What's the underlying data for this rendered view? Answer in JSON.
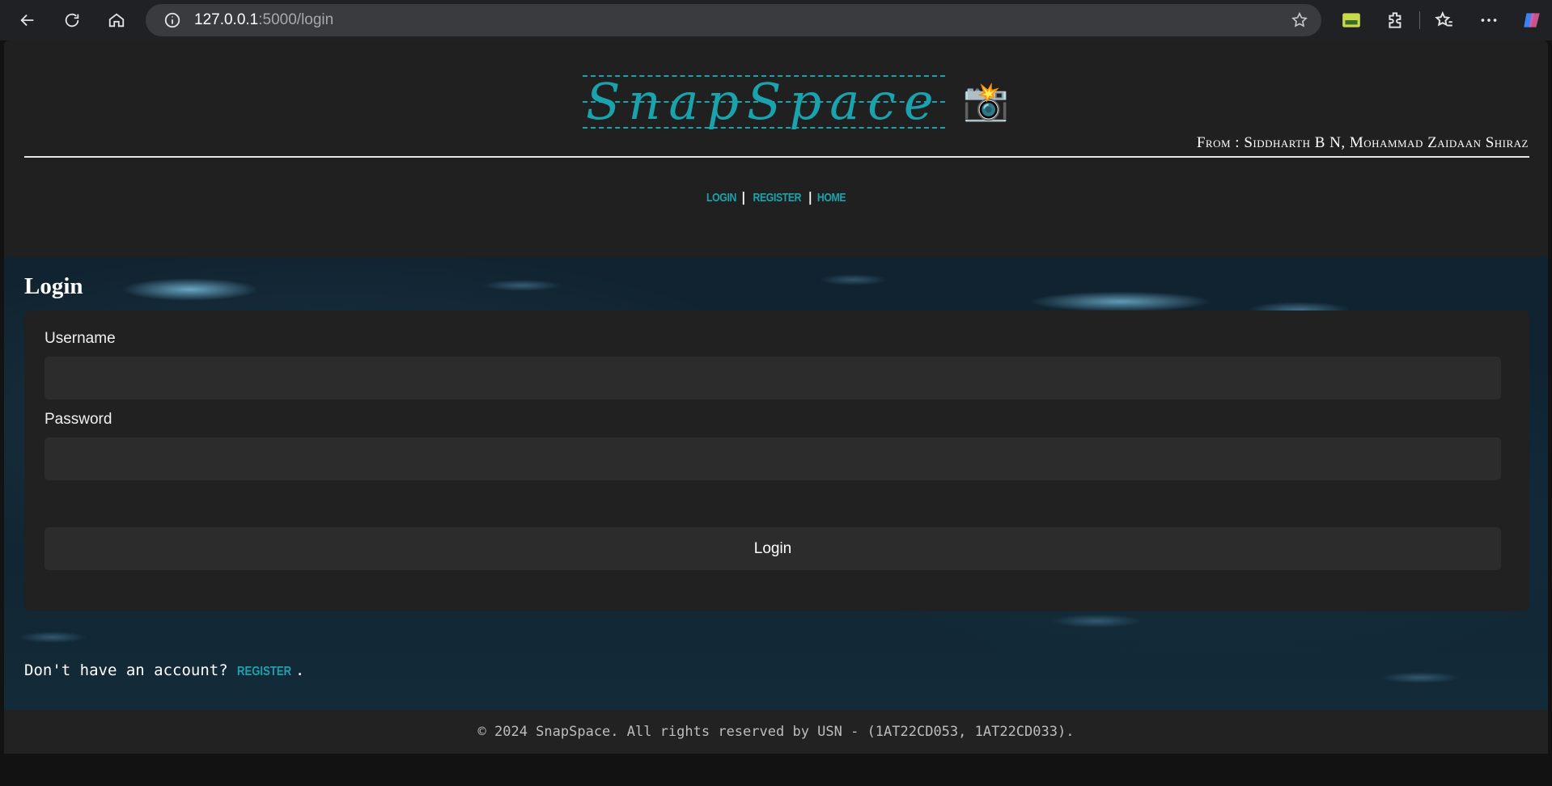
{
  "browser": {
    "url_host": "127.0.0.1",
    "url_path": ":5000/login"
  },
  "header": {
    "logo_text": "SnapSpace",
    "logo_emoji": "📸",
    "authors": "From : Siddharth B N, Mohammad Zaidaan Shiraz"
  },
  "nav": {
    "login": "LOGIN",
    "register": "REGISTER",
    "home": "HOME",
    "separator": "|"
  },
  "main": {
    "title": "Login",
    "username_label": "Username",
    "password_label": "Password",
    "username_value": "",
    "password_value": "",
    "submit_label": "Login",
    "signup_prompt": "Don't have an account?",
    "signup_link": "REGISTER",
    "signup_suffix": "."
  },
  "footer": {
    "text": "© 2024 SnapSpace. All rights reserved by USN - (1AT22CD053, 1AT22CD033)."
  },
  "colors": {
    "accent": "#1aa3ad",
    "header_bg": "#202020",
    "card_bg": "#212121",
    "input_bg": "#2c2c2c"
  }
}
